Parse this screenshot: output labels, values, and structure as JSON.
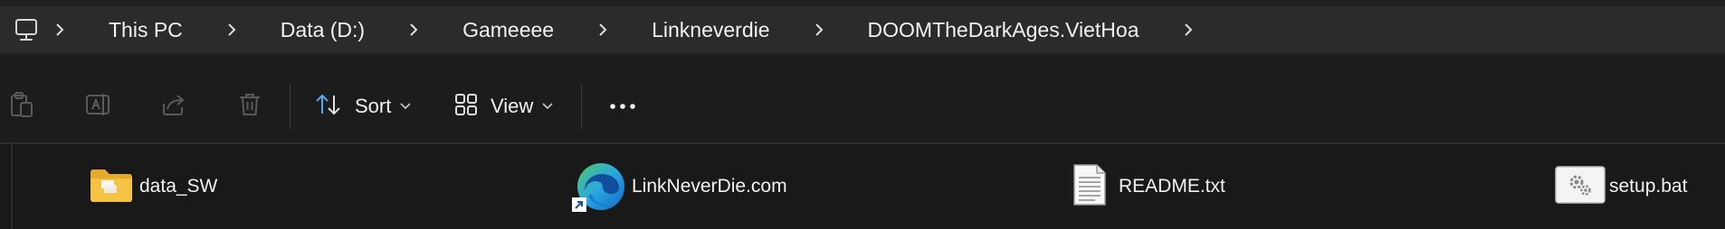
{
  "breadcrumb": {
    "items": [
      "This PC",
      "Data (D:)",
      "Gameeee",
      "Linkneverdie",
      "DOOMTheDarkAges.VietHoa"
    ]
  },
  "toolbar": {
    "sort_label": "Sort",
    "view_label": "View"
  },
  "files": [
    {
      "name": "data_SW",
      "icon": "folder-icon"
    },
    {
      "name": "LinkNeverDie.com",
      "icon": "edge-shortcut-icon"
    },
    {
      "name": "README.txt",
      "icon": "text-file-icon"
    },
    {
      "name": "setup.bat",
      "icon": "batch-file-icon"
    }
  ],
  "colors": {
    "background": "#1c1c1c",
    "address_bar": "#2b2b2b",
    "folder_yellow": "#f5c243",
    "edge_blue": "#1e8fd6",
    "edge_green": "#4fc86a",
    "sort_icon_blue": "#59a8f3"
  }
}
